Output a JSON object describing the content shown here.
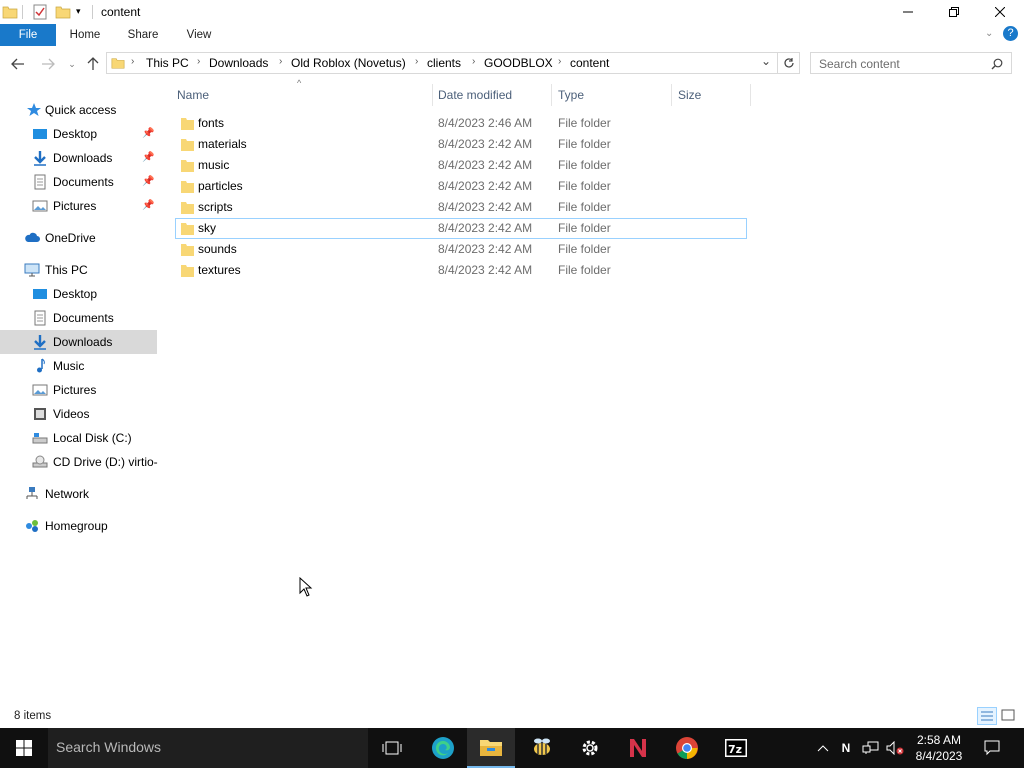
{
  "window": {
    "title": "content"
  },
  "ribbon": {
    "tabs": [
      "File",
      "Home",
      "Share",
      "View"
    ]
  },
  "address": {
    "crumbs": [
      "This PC",
      "Downloads",
      "Old Roblox (Novetus)",
      "clients",
      "GOODBLOX",
      "content"
    ]
  },
  "search": {
    "placeholder": "Search content"
  },
  "navpane": {
    "quick_access": "Quick access",
    "quick_items": [
      "Desktop",
      "Downloads",
      "Documents",
      "Pictures"
    ],
    "onedrive": "OneDrive",
    "this_pc": "This PC",
    "pc_items": [
      "Desktop",
      "Documents",
      "Downloads",
      "Music",
      "Pictures",
      "Videos",
      "Local Disk (C:)",
      "CD Drive (D:) virtio-"
    ],
    "network": "Network",
    "homegroup": "Homegroup",
    "selected": "Downloads"
  },
  "columns": {
    "name": "Name",
    "date": "Date modified",
    "type": "Type",
    "size": "Size"
  },
  "files": [
    {
      "name": "fonts",
      "date": "8/4/2023 2:46 AM",
      "type": "File folder"
    },
    {
      "name": "materials",
      "date": "8/4/2023 2:42 AM",
      "type": "File folder"
    },
    {
      "name": "music",
      "date": "8/4/2023 2:42 AM",
      "type": "File folder"
    },
    {
      "name": "particles",
      "date": "8/4/2023 2:42 AM",
      "type": "File folder"
    },
    {
      "name": "scripts",
      "date": "8/4/2023 2:42 AM",
      "type": "File folder"
    },
    {
      "name": "sky",
      "date": "8/4/2023 2:42 AM",
      "type": "File folder"
    },
    {
      "name": "sounds",
      "date": "8/4/2023 2:42 AM",
      "type": "File folder"
    },
    {
      "name": "textures",
      "date": "8/4/2023 2:42 AM",
      "type": "File folder"
    }
  ],
  "status": {
    "count": "8 items"
  },
  "taskbar": {
    "search": "Search Windows",
    "time": "2:58 AM",
    "date": "8/4/2023"
  },
  "colors": {
    "accent": "#1979ca",
    "folder": "#f8d775",
    "selection": "#d9d9d9",
    "focus_border": "#99d1ff"
  }
}
